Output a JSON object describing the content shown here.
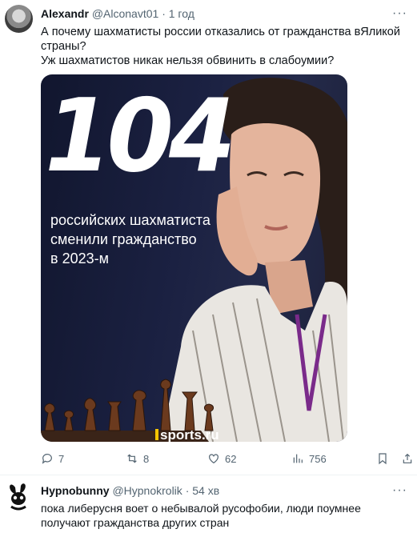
{
  "tweet": {
    "author_name": "Alexandr",
    "handle": "@Alconavt01",
    "dot": "·",
    "time": "1 год",
    "more": "···",
    "text_line1": "А почему шахматисты россии  отказались от гражданства вЯликой страны?",
    "text_line2": "Уж шахматистов никак нельзя обвинить в слабоумии?",
    "media": {
      "big_number": "104",
      "caption_line1": "российских шахматиста",
      "caption_line2": "сменили гражданство",
      "caption_line3": "в 2023-м",
      "brand": "sports.ru"
    },
    "actions": {
      "replies": "7",
      "reposts": "8",
      "likes": "62",
      "views": "756"
    }
  },
  "reply": {
    "author_name": "Hypnobunny",
    "handle": "@Hypnokrolik",
    "dot": "·",
    "time": "54 хв",
    "more": "···",
    "text": "пока либерусня воет о небывалой русофобии, люди поумнее получают гражданства других стран"
  },
  "colors": {
    "text": "#0f1419",
    "muted": "#536471",
    "divider": "#eff3f4",
    "media_bg": "#1b2142",
    "brand_accent": "#f5c400"
  }
}
